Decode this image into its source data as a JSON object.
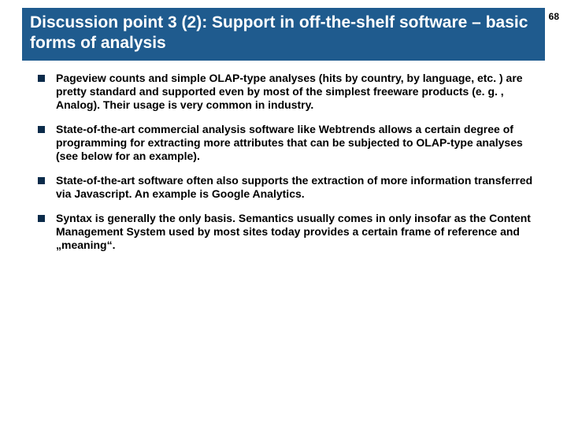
{
  "page_number": "68",
  "title": "Discussion point 3 (2): Support in off-the-shelf software – basic forms of analysis",
  "bullets": [
    "Pageview counts and simple OLAP-type analyses (hits by country, by language, etc. ) are pretty standard and supported even by most of the simplest freeware products (e. g. , Analog). Their usage is very common in industry.",
    "State-of-the-art commercial analysis software like Webtrends allows a certain degree of programming for extracting more attributes that can be subjected to OLAP-type analyses (see below for an example).",
    "State-of-the-art software often also supports the extraction of more information transferred via Javascript. An example is Google Analytics.",
    "Syntax is generally the only basis. Semantics usually comes in only insofar as the Content Management System used by most sites today provides a certain frame of reference and „meaning“."
  ]
}
